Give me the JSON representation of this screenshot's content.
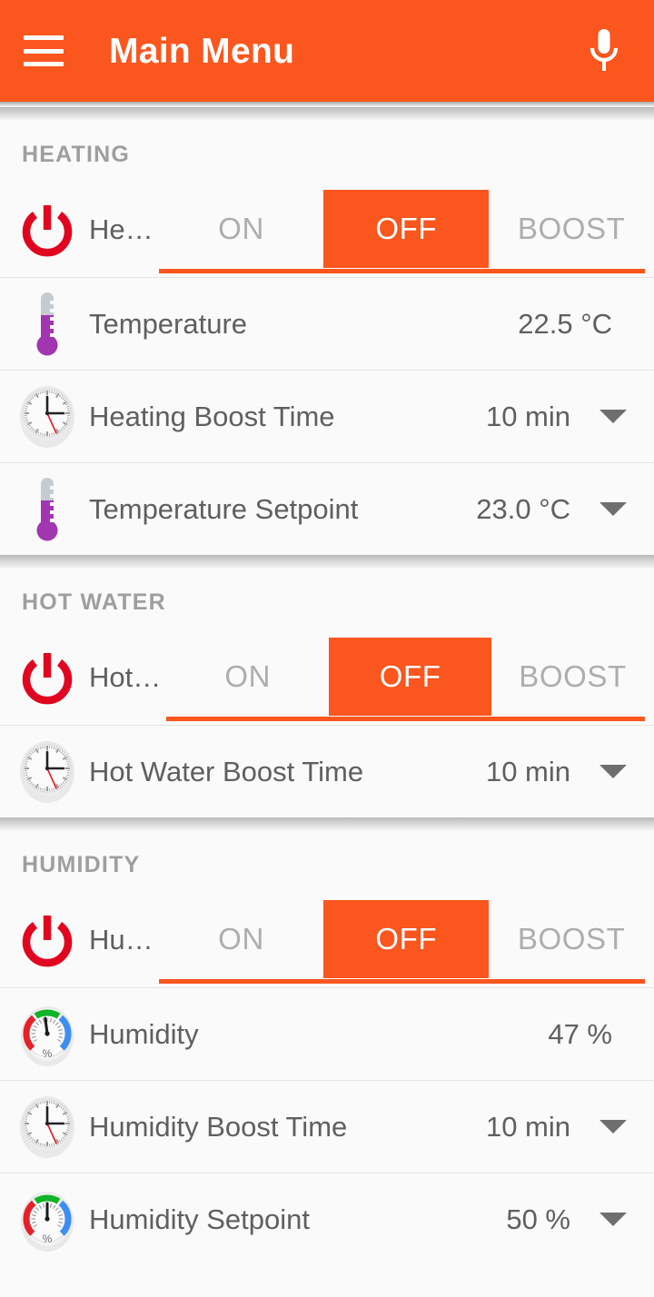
{
  "appbar": {
    "menu_icon": "hamburger-menu-icon",
    "title": "Main Menu",
    "mic_icon": "microphone-icon"
  },
  "theme": {
    "accent": "#fa561e",
    "background": "#fafafa",
    "text": "#5f5f5f",
    "muted_text": "#9e9e9e",
    "segment_inactive_text": "#adadad",
    "power_icon_color": "#e1051f",
    "thermometer_color": "#a235b0",
    "gauge_red": "#e8202a",
    "gauge_green": "#0fb428",
    "gauge_blue": "#3e8ef0",
    "clock_hand_red": "#e8202a"
  },
  "segments": {
    "on": "ON",
    "off": "OFF",
    "boost": "BOOST"
  },
  "sections": [
    {
      "title": "HEATING",
      "toggle": {
        "icon": "power-icon",
        "label": "He…",
        "selected": "OFF"
      },
      "rows": [
        {
          "icon": "thermometer-icon",
          "label": "Temperature",
          "value": "22.5 °C",
          "has_caret": false
        },
        {
          "icon": "clock-icon",
          "label": "Heating Boost Time",
          "value": "10 min",
          "has_caret": true
        },
        {
          "icon": "thermometer-icon",
          "label": "Temperature Setpoint",
          "value": "23.0 °C",
          "has_caret": true
        }
      ]
    },
    {
      "title": "HOT WATER",
      "toggle": {
        "icon": "power-icon",
        "label": "Hot…",
        "selected": "OFF"
      },
      "rows": [
        {
          "icon": "clock-icon",
          "label": "Hot Water Boost Time",
          "value": "10 min",
          "has_caret": true
        }
      ]
    },
    {
      "title": "HUMIDITY",
      "toggle": {
        "icon": "power-icon",
        "label": "Hu…",
        "selected": "OFF"
      },
      "rows": [
        {
          "icon": "humidity-gauge-icon",
          "label": "Humidity",
          "value": "47 %",
          "has_caret": false
        },
        {
          "icon": "clock-icon",
          "label": "Humidity Boost Time",
          "value": "10 min",
          "has_caret": true
        },
        {
          "icon": "humidity-gauge-icon",
          "label": "Humidity Setpoint",
          "value": "50 %",
          "has_caret": true
        }
      ]
    }
  ]
}
